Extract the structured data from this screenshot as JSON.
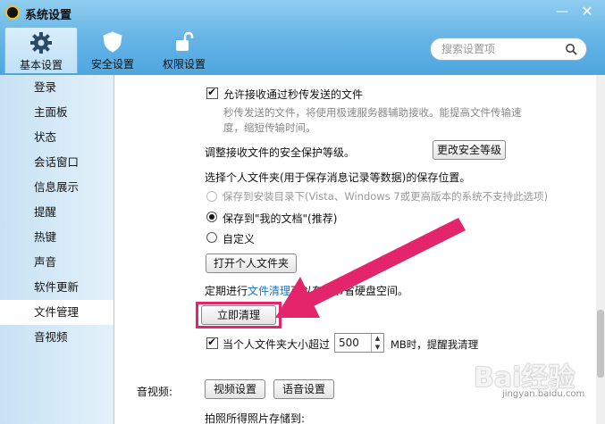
{
  "window": {
    "title": "系统设置",
    "minimize_icon": "minimize-icon",
    "close_icon": "close-icon"
  },
  "tabs": [
    {
      "label": "基本设置",
      "icon": "gear-icon",
      "active": true
    },
    {
      "label": "安全设置",
      "icon": "shield-icon",
      "active": false
    },
    {
      "label": "权限设置",
      "icon": "unlock-icon",
      "active": false
    }
  ],
  "search": {
    "placeholder": "搜索设置项",
    "icon": "search-icon"
  },
  "sidebar": {
    "items": [
      {
        "label": "登录"
      },
      {
        "label": "主面板"
      },
      {
        "label": "状态"
      },
      {
        "label": "会话窗口"
      },
      {
        "label": "信息展示"
      },
      {
        "label": "提醒"
      },
      {
        "label": "热键"
      },
      {
        "label": "声音"
      },
      {
        "label": "软件更新"
      },
      {
        "label": "文件管理",
        "active": true
      },
      {
        "label": "音视频"
      }
    ]
  },
  "file_management": {
    "allow_flash_label": "允许接收通过秒传发送的文件",
    "allow_flash_checked": true,
    "allow_flash_desc_1": "秒传发送的文件，将使用极速服务器辅助接收。能提高文件传输速",
    "allow_flash_desc_2": "度，缩短传输时间。",
    "security_level_label": "调整接收文件的安全保护等级。",
    "change_security_button": "更改安全等级",
    "folder_location_label": "选择个人文件夹(用于保存消息记录等数据)的保存位置。",
    "folder_options": [
      {
        "label": "保存到安装目录下(Vista、Windows 7或更高版本的系统不支持此选项)",
        "disabled": true,
        "checked": false
      },
      {
        "label": "保存到\"我的文档\"(推荐)",
        "disabled": false,
        "checked": true
      },
      {
        "label": "自定义",
        "disabled": false,
        "checked": false
      }
    ],
    "open_folder_button": "打开个人文件夹",
    "cleanup_prefix": "定期进行",
    "cleanup_link": "文件清理",
    "cleanup_suffix": "可以有效节省硬盘空间。",
    "clean_now_button": "立即清理",
    "size_limit_label": "当个人文件夹大小超过",
    "size_limit_checked": true,
    "size_limit_value": "500",
    "size_limit_suffix": "MB时，提醒我清理"
  },
  "av": {
    "section_label": "音视频:",
    "video_button": "视频设置",
    "voice_button": "语音设置",
    "photo_save_label": "拍照所得照片存储到:"
  },
  "annotation": {
    "arrow_color": "#e5256b"
  },
  "watermark": {
    "text": "Bai经验",
    "sub": "jingyan.baidu.com"
  }
}
